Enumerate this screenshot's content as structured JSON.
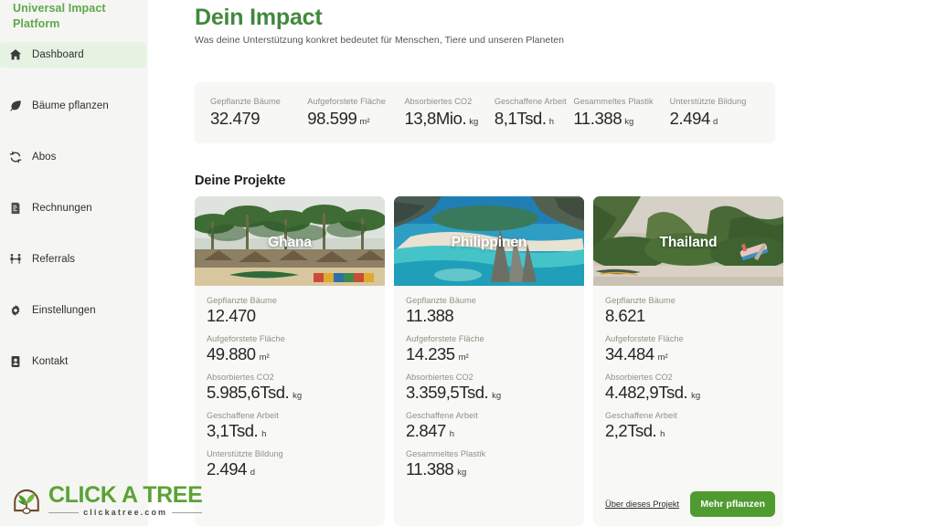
{
  "sidebar": {
    "brand": "Universal Impact Platform",
    "items": [
      {
        "label": "Dashboard",
        "icon": "home-icon",
        "active": true
      },
      {
        "label": "Bäume pflanzen",
        "icon": "leaf-icon",
        "active": false
      },
      {
        "label": "Abos",
        "icon": "refresh-icon",
        "active": false
      },
      {
        "label": "Rechnungen",
        "icon": "invoice-icon",
        "active": false
      },
      {
        "label": "Referrals",
        "icon": "referral-icon",
        "active": false
      },
      {
        "label": "Einstellungen",
        "icon": "gear-icon",
        "active": false
      },
      {
        "label": "Kontakt",
        "icon": "contact-icon",
        "active": false
      }
    ]
  },
  "logo": {
    "title": "CLICK A TREE",
    "domain": "clickatree.com"
  },
  "header": {
    "title": "Dein Impact",
    "subtitle": "Was deine Unterstützung konkret bedeutet für Menschen, Tiere und unseren Planeten"
  },
  "stats": [
    {
      "label": "Gepflanzte Bäume",
      "value": "32.479",
      "unit": ""
    },
    {
      "label": "Aufgeforstete Fläche",
      "value": "98.599",
      "unit": "m²"
    },
    {
      "label": "Absorbiertes CO2",
      "value": "13,8Mio.",
      "unit": "kg"
    },
    {
      "label": "Geschaffene Arbeit",
      "value": "8,1Tsd.",
      "unit": "h"
    },
    {
      "label": "Gesammeltes Plastik",
      "value": "11.388",
      "unit": "kg"
    },
    {
      "label": "Unterstützte Bildung",
      "value": "2.494",
      "unit": "d"
    }
  ],
  "projects_section": {
    "title": "Deine Projekte",
    "about_link_label": "Über dieses Projekt",
    "plant_button_label": "Mehr pflanzen"
  },
  "projects": [
    {
      "name": "Ghana",
      "scene": "palm-beach-village",
      "metrics": [
        {
          "label": "Gepflanzte Bäume",
          "value": "12.470",
          "unit": ""
        },
        {
          "label": "Aufgeforstete Fläche",
          "value": "49.880",
          "unit": "m²"
        },
        {
          "label": "Absorbiertes CO2",
          "value": "5.985,6Tsd.",
          "unit": "kg"
        },
        {
          "label": "Geschaffene Arbeit",
          "value": "3,1Tsd.",
          "unit": "h"
        },
        {
          "label": "Unterstützte Bildung",
          "value": "2.494",
          "unit": "d"
        }
      ]
    },
    {
      "name": "Philippinen",
      "scene": "turquoise-lagoon",
      "metrics": [
        {
          "label": "Gepflanzte Bäume",
          "value": "11.388",
          "unit": ""
        },
        {
          "label": "Aufgeforstete Fläche",
          "value": "14.235",
          "unit": "m²"
        },
        {
          "label": "Absorbiertes CO2",
          "value": "3.359,5Tsd.",
          "unit": "kg"
        },
        {
          "label": "Geschaffene Arbeit",
          "value": "2.847",
          "unit": "h"
        },
        {
          "label": "Gesammeltes Plastik",
          "value": "11.388",
          "unit": "kg"
        }
      ]
    },
    {
      "name": "Thailand",
      "scene": "limestone-cliff-bay",
      "metrics": [
        {
          "label": "Gepflanzte Bäume",
          "value": "8.621",
          "unit": ""
        },
        {
          "label": "Aufgeforstete Fläche",
          "value": "34.484",
          "unit": "m²"
        },
        {
          "label": "Absorbiertes CO2",
          "value": "4.482,9Tsd.",
          "unit": "kg"
        },
        {
          "label": "Geschaffene Arbeit",
          "value": "2,2Tsd.",
          "unit": "h"
        }
      ],
      "has_footer": true
    }
  ],
  "colors": {
    "brand_green": "#5fa84a",
    "title_green": "#41883d",
    "button_green": "#4f9b2f",
    "label_olive": "#8b9480",
    "sidebar_bg": "#f5f5f3",
    "card_bg": "#f8f8f6",
    "active_nav_bg": "#e6f3e3"
  }
}
